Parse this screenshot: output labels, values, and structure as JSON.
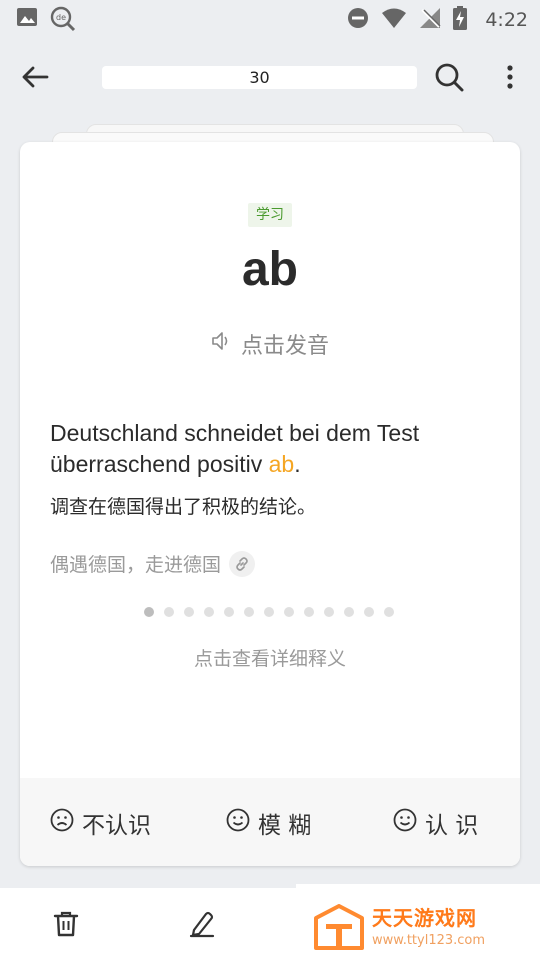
{
  "status_bar": {
    "time": "4:22",
    "icons": [
      "image-icon",
      "dict-search-icon",
      "dnd-icon",
      "wifi-icon",
      "no-signal-icon",
      "battery-charging-icon"
    ]
  },
  "app_bar": {
    "counter": "30",
    "icons": [
      "back-arrow-icon",
      "search-icon",
      "more-vert-icon"
    ]
  },
  "card": {
    "tag": "学习",
    "word": "ab",
    "pronounce_label": "点击发音",
    "example_before": "Deutschland schneidet bei dem Test überraschend positiv ",
    "example_highlight": "ab",
    "example_after": ".",
    "translation": "调查在德国得出了积极的结论。",
    "source": "偶遇德国，走进德国",
    "dots_total": 13,
    "dots_active_index": 0,
    "detail_label": "点击查看详细释义",
    "highlight_color": "#f5a623"
  },
  "actions": {
    "unknown": "不认识",
    "vague": "模 糊",
    "known": "认 识"
  },
  "bottom_bar": {
    "icons": [
      "trash-icon",
      "edit-icon"
    ]
  },
  "watermark": {
    "main": "天天游戏网",
    "sub": "www.ttyl123.com"
  }
}
